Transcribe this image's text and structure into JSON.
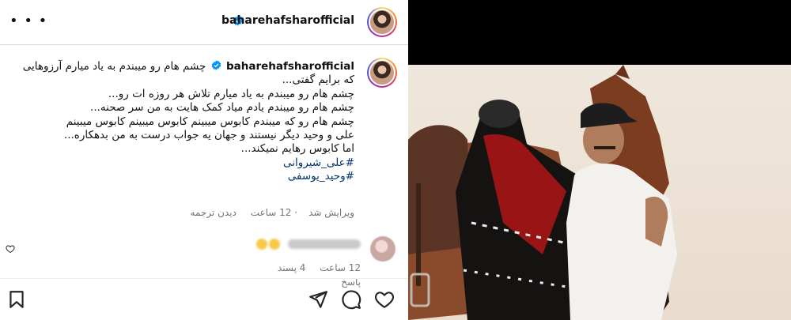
{
  "post": {
    "username": "baharehafsharofficial",
    "more_icon": "more-dots-icon",
    "verified_icon": "verified-badge-icon",
    "caption": {
      "lines": [
        "چشم هام رو میبندم به یاد میارم آرزوهایی",
        "که برایم گفتی...",
        "چشم هام رو میبندم به یاد میارم تلاش هر روزه ات رو...",
        "چشم هام رو میبندم یادم میاد کمک هایت به من سر صحنه...",
        "چشم هام رو که میبندم کابوس میبینم کابوس میبینم کابوس میبینم",
        "علی و وحید دیگر نیستند و جهان یه جواب درست به من بدهکاره...",
        "اما کابوس رهایم نمیکند..."
      ],
      "hashtags": [
        "#علی_شیروانی",
        "#وحید_یوسفی"
      ]
    },
    "meta": {
      "edited": "ویرایش شد",
      "time": "12 ساعت",
      "translate": "دیدن ترجمه"
    },
    "comment": {
      "time": "12 ساعت",
      "likes": "4 پسند",
      "reply": "پاسخ"
    }
  },
  "actions": {
    "like_icon": "heart-icon",
    "comment_icon": "comment-icon",
    "share_icon": "send-icon",
    "save_icon": "bookmark-icon"
  },
  "colors": {
    "hashtag": "#00376b",
    "verified": "#0095f6",
    "muted": "#737373"
  }
}
